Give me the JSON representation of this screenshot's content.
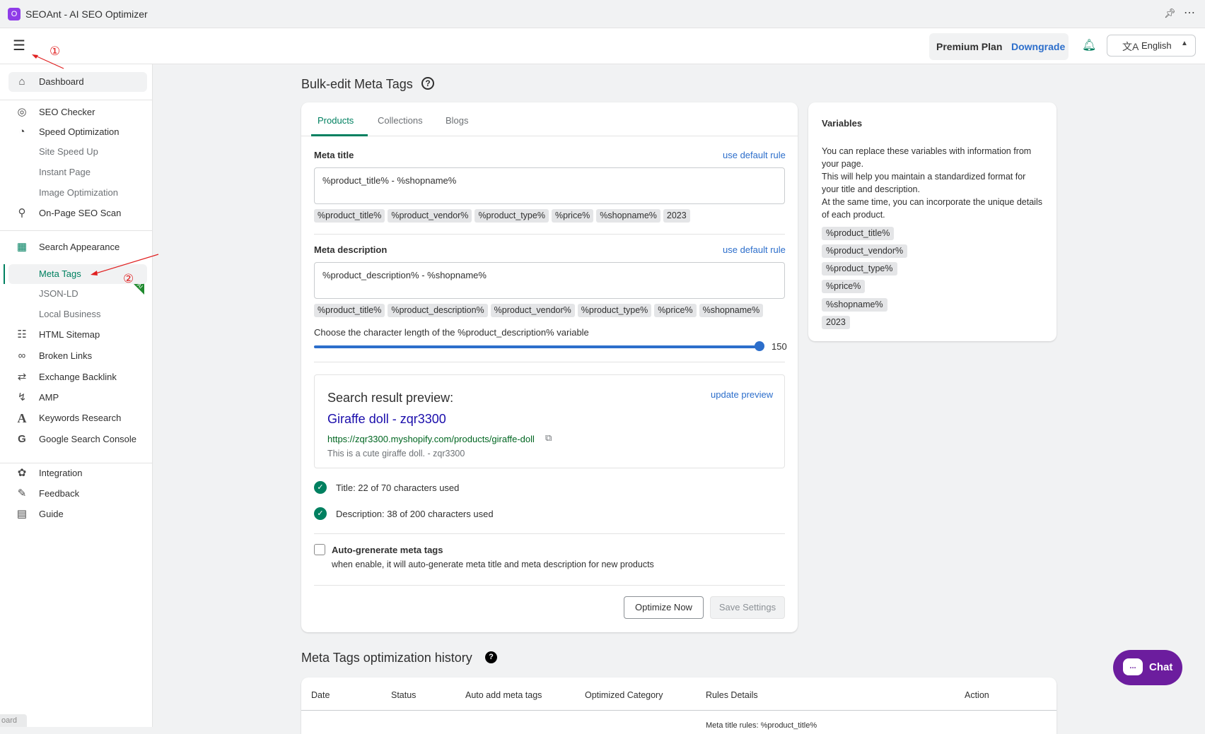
{
  "window": {
    "app_icon": "O",
    "title": "SEOAnt - AI SEO Optimizer",
    "pin_icon": "pin-icon",
    "more_icon": "more-icon"
  },
  "header": {
    "plan_label": "Premium Plan",
    "downgrade_label": "Downgrade",
    "language": "English"
  },
  "sidebar": {
    "items": [
      {
        "label": "Dashboard",
        "icon": "home-icon"
      },
      {
        "label": "SEO Checker",
        "icon": "target-icon"
      },
      {
        "label": "Speed Optimization",
        "icon": "speedometer-icon"
      },
      {
        "label": "Site Speed Up"
      },
      {
        "label": "Instant Page"
      },
      {
        "label": "Image Optimization"
      },
      {
        "label": "On-Page SEO Scan",
        "icon": "search-icon"
      },
      {
        "label": "Search Appearance",
        "icon": "grid-icon"
      },
      {
        "label": "Meta Tags"
      },
      {
        "label": "JSON-LD"
      },
      {
        "label": "Local Business"
      },
      {
        "label": "HTML Sitemap",
        "icon": "sitemap-icon"
      },
      {
        "label": "Broken Links",
        "icon": "broken-link-icon"
      },
      {
        "label": "Exchange Backlink",
        "icon": "exchange-icon"
      },
      {
        "label": "AMP",
        "icon": "lightning-icon"
      },
      {
        "label": "Keywords Research",
        "icon": "font-a-icon"
      },
      {
        "label": "Google Search Console",
        "icon": "google-icon"
      },
      {
        "label": "Integration",
        "icon": "integration-icon"
      },
      {
        "label": "Feedback",
        "icon": "feedback-icon"
      },
      {
        "label": "Guide",
        "icon": "guide-icon"
      }
    ],
    "ai_badge": "AI",
    "board_tag": "oard"
  },
  "page": {
    "title": "Bulk-edit Meta Tags",
    "help_icon": "?"
  },
  "tabs": [
    "Products",
    "Collections",
    "Blogs"
  ],
  "meta_title": {
    "label": "Meta title",
    "link": "use default rule",
    "value": "%product_title% - %shopname%",
    "chips": [
      "%product_title%",
      "%product_vendor%",
      "%product_type%",
      "%price%",
      "%shopname%",
      "2023"
    ]
  },
  "meta_desc": {
    "label": "Meta description",
    "link": "use default rule",
    "value": "%product_description% - %shopname%",
    "chips": [
      "%product_title%",
      "%product_description%",
      "%product_vendor%",
      "%product_type%",
      "%price%",
      "%shopname%"
    ]
  },
  "slider": {
    "label": "Choose the character length of the %product_description% variable",
    "value": "150",
    "fraction": 1.0
  },
  "preview": {
    "heading": "Search result preview:",
    "update_link": "update preview",
    "title": "Giraffe doll - zqr3300",
    "url": "https://zqr3300.myshopify.com/products/giraffe-doll",
    "description": "This is a cute giraffe doll. - zqr3300"
  },
  "checks": {
    "title": "Title: 22 of 70 characters used",
    "description": "Description: 38 of 200 characters used"
  },
  "auto": {
    "title": "Auto-grenerate meta tags",
    "desc": "when enable, it will auto-generate meta title and meta description for new products"
  },
  "buttons": {
    "optimize": "Optimize Now",
    "save": "Save Settings"
  },
  "variables": {
    "title": "Variables",
    "lines": [
      "You can replace these variables with information from your page.",
      "This will help you maintain a standardized format for your title and description.",
      "At the same time, you can incorporate the unique details of each product."
    ],
    "chips": [
      "%product_title%",
      "%product_vendor%",
      "%product_type%",
      "%price%",
      "%shopname%",
      "2023"
    ]
  },
  "history": {
    "title": "Meta Tags optimization history",
    "help_icon": "?",
    "columns": [
      "Date",
      "Status",
      "Auto add meta tags",
      "Optimized Category",
      "Rules Details",
      "Action"
    ],
    "rules_snippet": "Meta title rules: %product_title%"
  },
  "chat": {
    "label": "Chat",
    "icon": "..."
  },
  "annotations": {
    "marker1": "①",
    "marker2": "②"
  },
  "colors": {
    "accent": "#008060",
    "link": "#2c6ecb",
    "chat": "#6c1d9e",
    "annotation": "#e02020"
  }
}
